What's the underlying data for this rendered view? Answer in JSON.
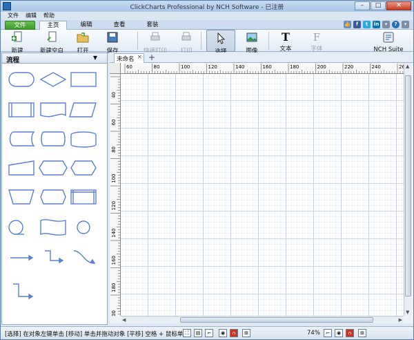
{
  "window": {
    "title": "ClickCharts Professional by NCH Software - 已注册"
  },
  "menubar": {
    "items": [
      "文件",
      "编辑",
      "帮助"
    ]
  },
  "ribbon_tabs": {
    "file": "文件",
    "home": "主页",
    "edit": "编辑",
    "view": "查看",
    "suite": "套装"
  },
  "toolbar": {
    "new": "新建",
    "new_blank": "新建空白",
    "open": "打开",
    "save": "保存",
    "quick_print": "快速打印",
    "print": "打印",
    "select": "选择",
    "image": "图像",
    "text": "文本",
    "font": "字体",
    "nch_suite": "NCH Suite"
  },
  "panel": {
    "title": "流程"
  },
  "document": {
    "tab_name": "未命名",
    "add_tab": "+"
  },
  "ruler": {
    "h_labels": [
      "60",
      "80",
      "100",
      "120",
      "140",
      "160",
      "180",
      "200",
      "220",
      "240",
      "260"
    ],
    "v_labels": [
      "40",
      "60",
      "80",
      "100",
      "120",
      "140",
      "160",
      "180",
      "200"
    ]
  },
  "status": {
    "hint": "[选择] 在对象左键单击 [移动] 单击并拖动对象 [平移] 空格 + 鼠标单",
    "zoom": "74%"
  },
  "colors": {
    "shape_stroke": "#5b7fd4",
    "file_tab": "#3f9a2b",
    "accent": "#2a6cb5"
  }
}
